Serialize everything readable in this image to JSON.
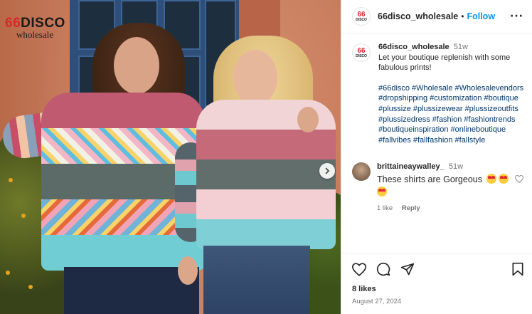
{
  "photo": {
    "brand_logo": {
      "number": "66",
      "word": "DISCO",
      "tagline": "wholesale"
    },
    "next_icon": "chevron-right-icon"
  },
  "header": {
    "username": "66disco_wholesale",
    "separator": "•",
    "follow_label": "Follow",
    "more_icon": "more-horizontal-icon",
    "more_label": "···"
  },
  "avatar": {
    "number": "66",
    "word": "DISCO"
  },
  "caption": {
    "username": "66disco_wholesale",
    "time": "51w",
    "text": "Let your boutique replenish with some fabulous prints!",
    "hashtags": [
      "#66disco",
      "#Wholesale",
      "#Wholesalevendors",
      "#dropshipping",
      "#customization",
      "#boutique",
      "#plussize",
      "#plussizewear",
      "#plussizeoutfits",
      "#plussizedress",
      "#fashion",
      "#fashiontrends",
      "#boutiqueinspiration",
      "#onlineboutique",
      "#fallvibes",
      "#fallfashion",
      "#fallstyle"
    ]
  },
  "comment": {
    "username": "brittaineaywalley_",
    "time": "51w",
    "text": "These shirts are Gorgeous",
    "likes": "1 like",
    "reply_label": "Reply",
    "like_icon": "heart-outline-icon"
  },
  "actions": {
    "icons": [
      "heart-outline-icon",
      "comment-icon",
      "share-icon",
      "bookmark-icon"
    ],
    "likes": "8 likes",
    "date": "August 27, 2024"
  },
  "colors": {
    "accent_blue": "#0095f6",
    "hashtag_blue": "#00376b",
    "logo_red": "#d82828",
    "muted_text": "#737373"
  }
}
